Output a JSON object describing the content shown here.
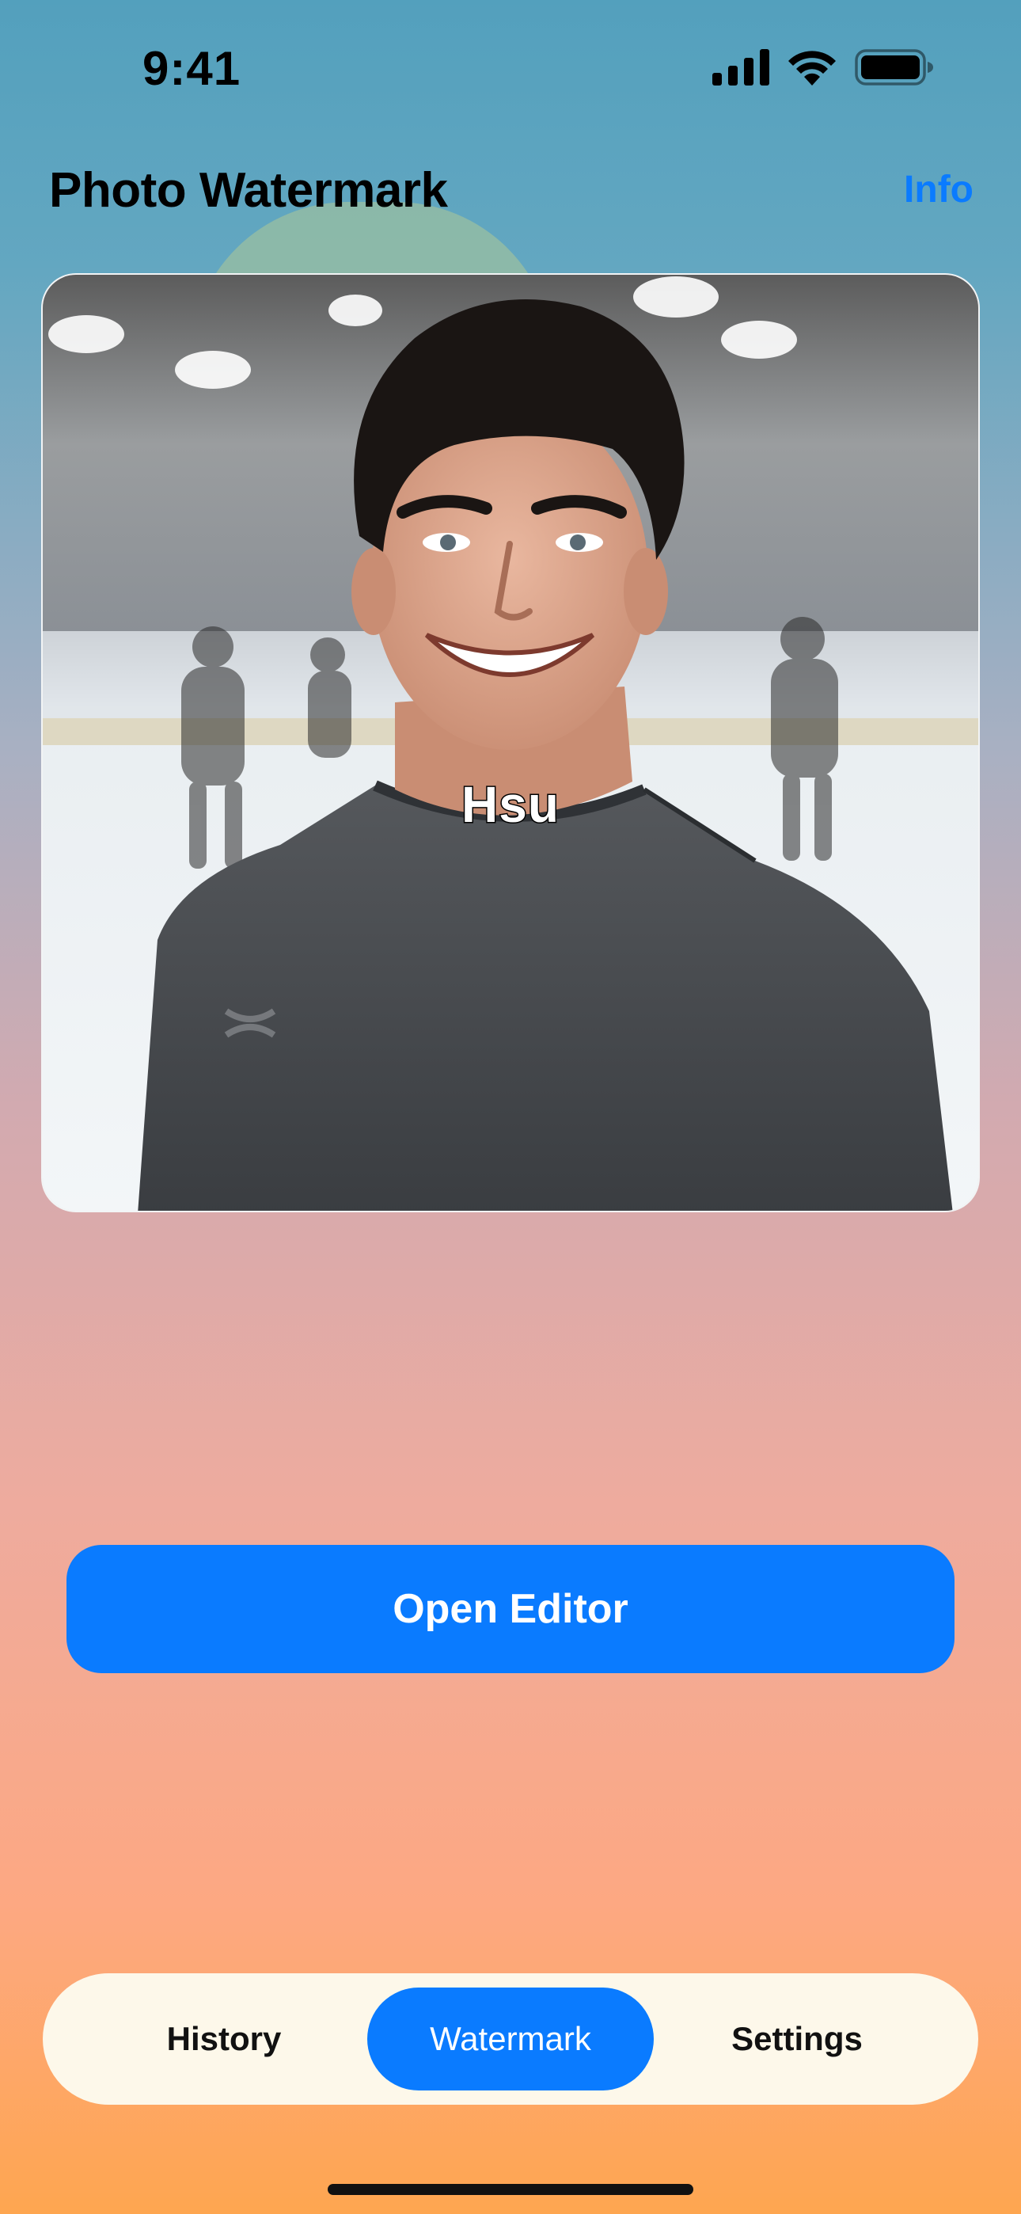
{
  "status_bar": {
    "time": "9:41",
    "icons": [
      "cellular-signal-icon",
      "wifi-icon",
      "battery-icon"
    ]
  },
  "header": {
    "title": "Photo Watermark",
    "info_label": "Info"
  },
  "preview": {
    "watermark_text": "Hsu"
  },
  "actions": {
    "open_editor_label": "Open Editor"
  },
  "tab_bar": {
    "tabs": [
      {
        "label": "History",
        "active": false
      },
      {
        "label": "Watermark",
        "active": true
      },
      {
        "label": "Settings",
        "active": false
      }
    ]
  },
  "colors": {
    "accent": "#0a7bff",
    "tab_bar_bg": "#fdf8ea"
  }
}
